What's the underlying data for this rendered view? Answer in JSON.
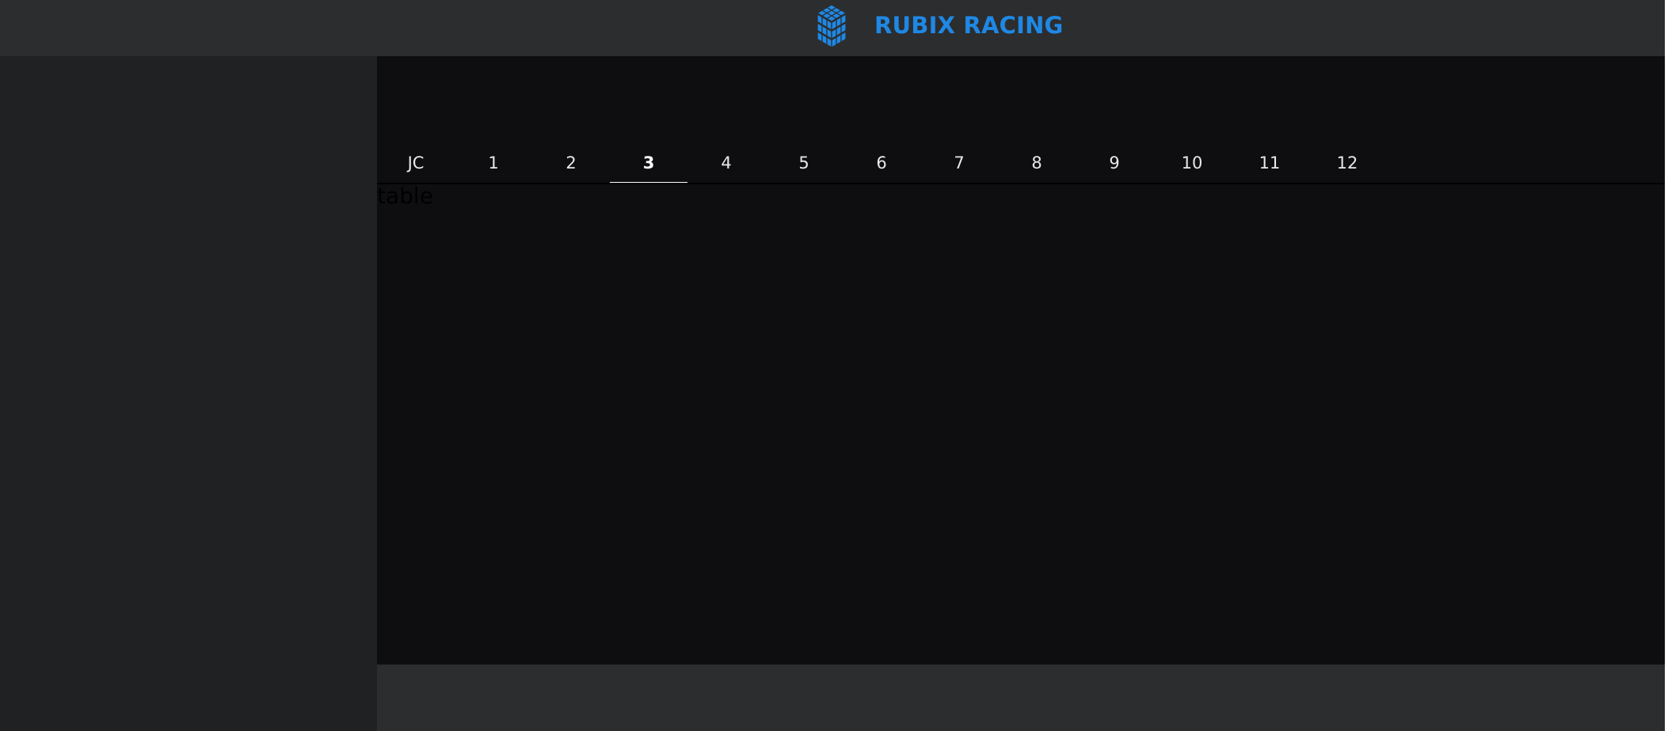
{
  "header": {
    "brand_name": "RUBIX RACING",
    "logo_icon": "rubiks-cube-icon",
    "accent_color": "#1e88e5"
  },
  "tabs": {
    "items": [
      {
        "label": "JC"
      },
      {
        "label": "1"
      },
      {
        "label": "2"
      },
      {
        "label": "3"
      },
      {
        "label": "4"
      },
      {
        "label": "5"
      },
      {
        "label": "6"
      },
      {
        "label": "7"
      },
      {
        "label": "8"
      },
      {
        "label": "9"
      },
      {
        "label": "10"
      },
      {
        "label": "11"
      },
      {
        "label": "12"
      }
    ],
    "active": "3"
  },
  "main": {
    "table_text": "table"
  }
}
